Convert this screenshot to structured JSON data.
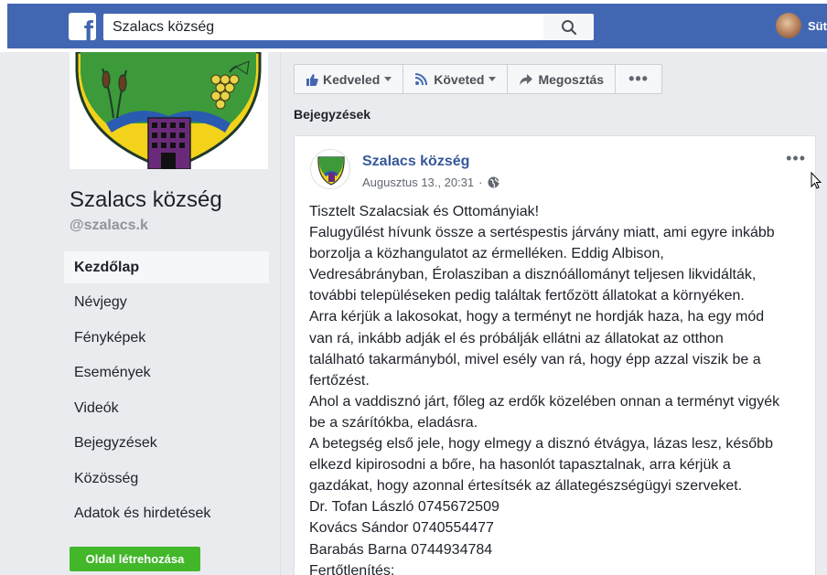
{
  "topbar": {
    "search_value": "Szalacs község",
    "user_name": "Süt"
  },
  "page": {
    "name": "Szalacs község",
    "handle": "@szalacs.k"
  },
  "nav": {
    "items": [
      {
        "label": "Kezdőlap",
        "active": true
      },
      {
        "label": "Névjegy"
      },
      {
        "label": "Fényképek"
      },
      {
        "label": "Események"
      },
      {
        "label": "Videók"
      },
      {
        "label": "Bejegyzések"
      },
      {
        "label": "Közösség"
      },
      {
        "label": "Adatok és hirdetések"
      }
    ],
    "create_button": "Oldal létrehozása"
  },
  "actions": {
    "like": "Kedveled",
    "follow": "Követed",
    "share": "Megosztás",
    "more": "•••"
  },
  "section_title": "Bejegyzések",
  "post": {
    "author": "Szalacs község",
    "date": "Augusztus 13., 20:31",
    "separator": "·",
    "menu": "•••",
    "lines": [
      "Tisztelt Szalacsiak és Ottományiak!",
      "Falugyűlést hívunk össze a sertéspestis járvány miatt, ami egyre inkább",
      "borzolja a közhangulatot az érmelléken. Eddig Albison,",
      "Vedresábrányban, Érolasziban a disznóállományt teljesen likvidálták,",
      "további településeken pedig találtak fertőzött állatokat a környéken.",
      "Arra kérjük a lakosokat, hogy a terményt ne hordják haza, ha egy mód",
      "van rá, inkább adják el és próbálják ellátni az állatokat az otthon",
      "található takarmányból, mivel esély van rá, hogy épp azzal viszik be a",
      "fertőzést.",
      "Ahol a vaddisznó járt, főleg az erdők közelében onnan a terményt vigyék",
      "be a szárítókba, eladásra.",
      "A betegség első jele, hogy elmegy a disznó étvágya, lázas lesz, később",
      "elkezd kipirosodni a bőre, ha hasonlót tapasztalnak, arra kérjük a",
      "gazdákat, hogy azonnal értesítsék az állategészségügyi szerveket.",
      "Dr. Tofan László 0745672509",
      "Kovács Sándor 0740554477",
      "Barabás Barna 0744934784",
      "Fertőtlenítés:"
    ]
  },
  "colors": {
    "brand_blue": "#4267b2",
    "link_blue": "#365899",
    "create_green": "#42b72a",
    "page_bg": "#e9ebee"
  }
}
